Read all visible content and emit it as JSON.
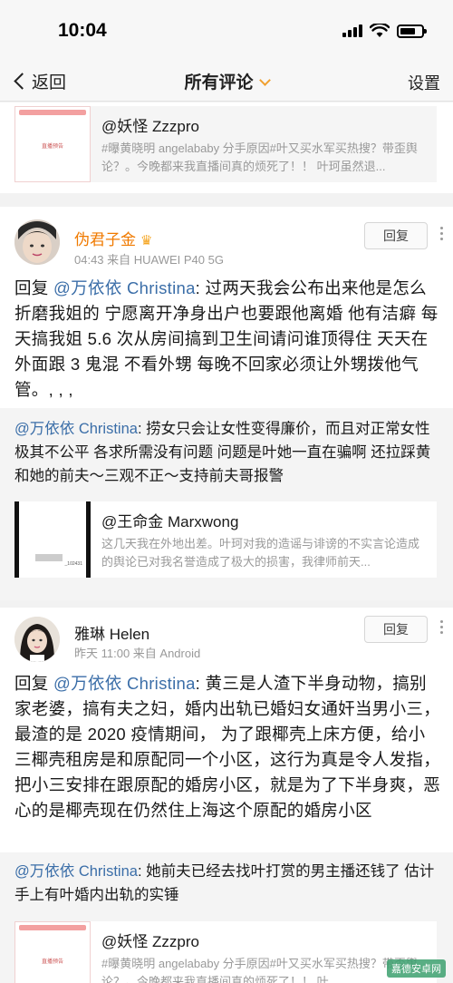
{
  "status": {
    "time": "10:04"
  },
  "nav": {
    "back_label": "返回",
    "title": "所有评论",
    "right_label": "设置"
  },
  "share1": {
    "thumb_caption": "直播预告",
    "title": "@妖怪 Zzzpro",
    "text": "#曝黄晓明 angelababy 分手原因#叶又买水军买热搜？带歪舆论？。今晚都来我直播间真的烦死了！！ 叶珂虽然退..."
  },
  "comment1": {
    "username": "伪君子金",
    "meta": "04:43  来自 HUAWEI P40 5G",
    "reply_button": "回复",
    "prefix": "回复 ",
    "mention": "@万依依 Christina",
    "text": ": 过两天我会公布出来他是怎么折磨我姐的 宁愿离开净身出户也要跟他离婚 他有洁癖 每天搞我姐 5.6 次从房间搞到卫生间请问谁顶得住 天天在外面跟 3 鬼混 不看外甥 每晚不回家必须让外甥拨他气管。, , ,"
  },
  "quote1": {
    "mention": "@万依依 Christina",
    "text": ": 捞女只会让女性变得廉价，而且对正常女性极其不公平  各求所需没有问题 问题是叶她一直在骗啊 还拉踩黄和她的前夫～三观不正～支持前夫哥报警"
  },
  "share2": {
    "thumb_caption": "_102431",
    "title": "@王命金 Marxwong",
    "text": "这几天我在外地出差。叶珂对我的造谣与诽谤的不实言论造成的舆论已对我名誉造成了极大的损害，我律师前天..."
  },
  "comment2": {
    "username": "雅琳 Helen",
    "meta": "昨天 11:00  来自 Android",
    "reply_button": "回复",
    "prefix": "回复 ",
    "mention": "@万依依 Christina",
    "text": ": 黄三是人渣下半身动物，搞别家老婆，搞有夫之妇，婚内出轨已婚妇女通奸当男小三，最渣的是 2020 疫情期间，  为了跟椰壳上床方便，给小三椰壳租房是和原配同一个小区，这行为真是令人发指，把小三安排在跟原配的婚房小区，就是为了下半身爽，恶心的是椰壳现在仍然住上海这个原配的婚房小区"
  },
  "quote2": {
    "mention": "@万依依 Christina",
    "text": ": 她前夫已经去找叶打赏的男主播还钱了 估计手上有叶婚内出轨的实锤"
  },
  "share3": {
    "thumb_caption": "直播预告",
    "title": "@妖怪 Zzzpro",
    "text": "#曝黄晓明 angelababy 分手原因#叶又买水军买热搜？带歪舆论？。今晚都来我直播间真的烦死了！！ 叶..."
  },
  "watermark": "嘉德安卓网"
}
